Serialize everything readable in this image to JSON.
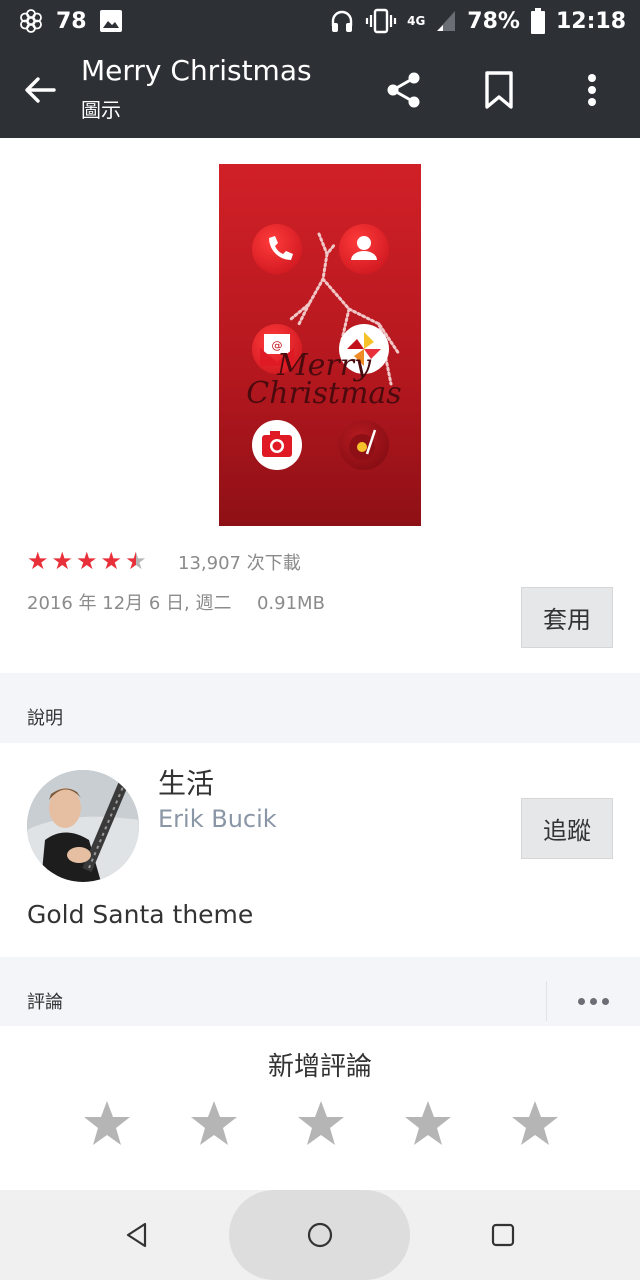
{
  "status_bar": {
    "notification_count": "78",
    "battery_percent": "78%",
    "time": "12:18",
    "network": "4G"
  },
  "app_bar": {
    "title": "Merry Christmas",
    "subtitle": "圖示"
  },
  "theme": {
    "rating_stars": 4.5,
    "downloads": "13,907 次下載",
    "date": "2016 年 12月 6 日, 週二",
    "size": "0.91MB",
    "apply_label": "套用"
  },
  "description_section": {
    "label": "說明",
    "category": "生活",
    "author": "Erik Bucik",
    "follow_label": "追蹤",
    "text": "Gold Santa theme"
  },
  "reviews_section": {
    "label": "評論",
    "add_review_label": "新增評論"
  },
  "colors": {
    "appbar_bg": "#2d3136",
    "star_filled": "#e8303a",
    "star_empty": "#b5b5b5"
  }
}
